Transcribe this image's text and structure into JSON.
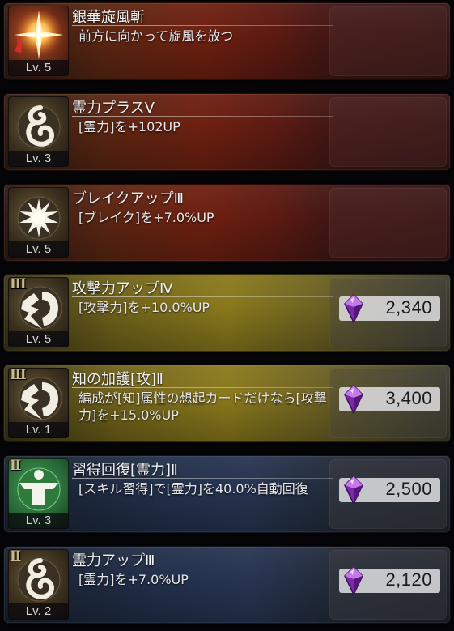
{
  "skills": [
    {
      "title": "銀華旋風斬",
      "desc": "前方に向かって旋風を放つ",
      "level": "Lv. 5",
      "rank": "",
      "price": "",
      "theme": "red",
      "icon": "star-burst-icon"
    },
    {
      "title": "霊力プラスⅤ",
      "desc": "[霊力]を+102UP",
      "level": "Lv. 3",
      "rank": "",
      "price": "",
      "theme": "red",
      "icon": "spirit-swirl-icon"
    },
    {
      "title": "ブレイクアップⅢ",
      "desc": "[ブレイク]を+7.0%UP",
      "level": "Lv. 5",
      "rank": "",
      "price": "",
      "theme": "red",
      "icon": "break-burst-icon"
    },
    {
      "title": "攻撃力アップⅣ",
      "desc": "[攻撃力]を+10.0%UP",
      "level": "Lv. 5",
      "rank": "Ⅲ",
      "price": "2,340",
      "theme": "gold",
      "icon": "attack-fist-icon"
    },
    {
      "title": "知の加護[攻]Ⅱ",
      "desc": "編成が[知]属性の想起カードだけなら[攻撃力]を+15.0%UP",
      "level": "Lv. 1",
      "rank": "Ⅲ",
      "price": "3,400",
      "theme": "gold",
      "icon": "attack-fist-icon"
    },
    {
      "title": "習得回復[霊力]Ⅱ",
      "desc": "[スキル習得]で[霊力]を40.0%自動回復",
      "level": "Lv. 3",
      "rank": "Ⅱ",
      "price": "2,500",
      "theme": "blue",
      "icon": "recovery-figure-icon"
    },
    {
      "title": "霊力アップⅢ",
      "desc": "[霊力]を+7.0%UP",
      "level": "Lv. 2",
      "rank": "Ⅱ",
      "price": "2,120",
      "theme": "blue",
      "icon": "spirit-swirl-icon"
    }
  ]
}
